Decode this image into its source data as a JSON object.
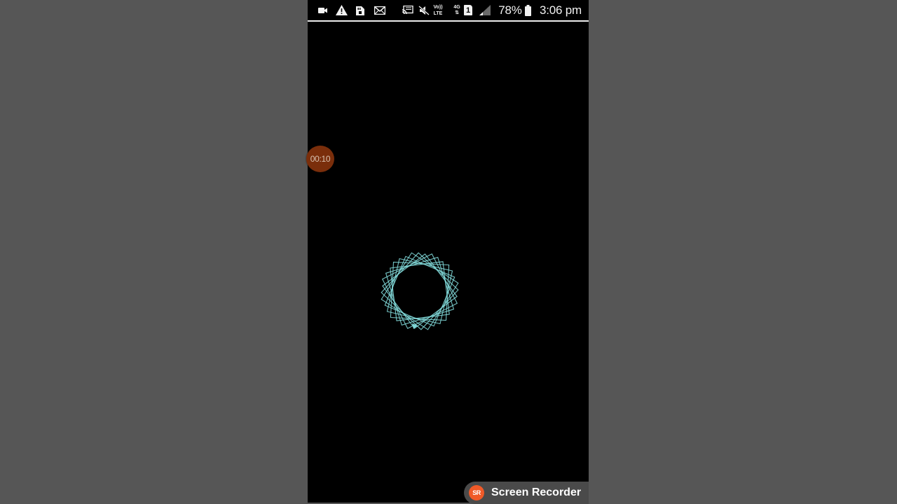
{
  "status_bar": {
    "icons": [
      "video-camera-icon",
      "warning-icon",
      "sd-card-icon",
      "email-icon",
      "cast-icon",
      "mute-icon",
      "volte-icon",
      "4g-icon",
      "sim-1-icon",
      "signal-icon",
      "battery-icon"
    ],
    "volte_label_top": "Vo))",
    "volte_label_bottom": "LTE",
    "network_label": "4G",
    "sim_label": "1",
    "battery_percent": "78%",
    "time": "3:06 pm"
  },
  "overlay": {
    "recording_timer": "00:10"
  },
  "canvas": {
    "stroke_color": "#7fd6d6",
    "background_color": "#000000"
  },
  "watermark": {
    "logo_text": "SR",
    "label": "Screen Recorder",
    "logo_color": "#f05a28"
  }
}
